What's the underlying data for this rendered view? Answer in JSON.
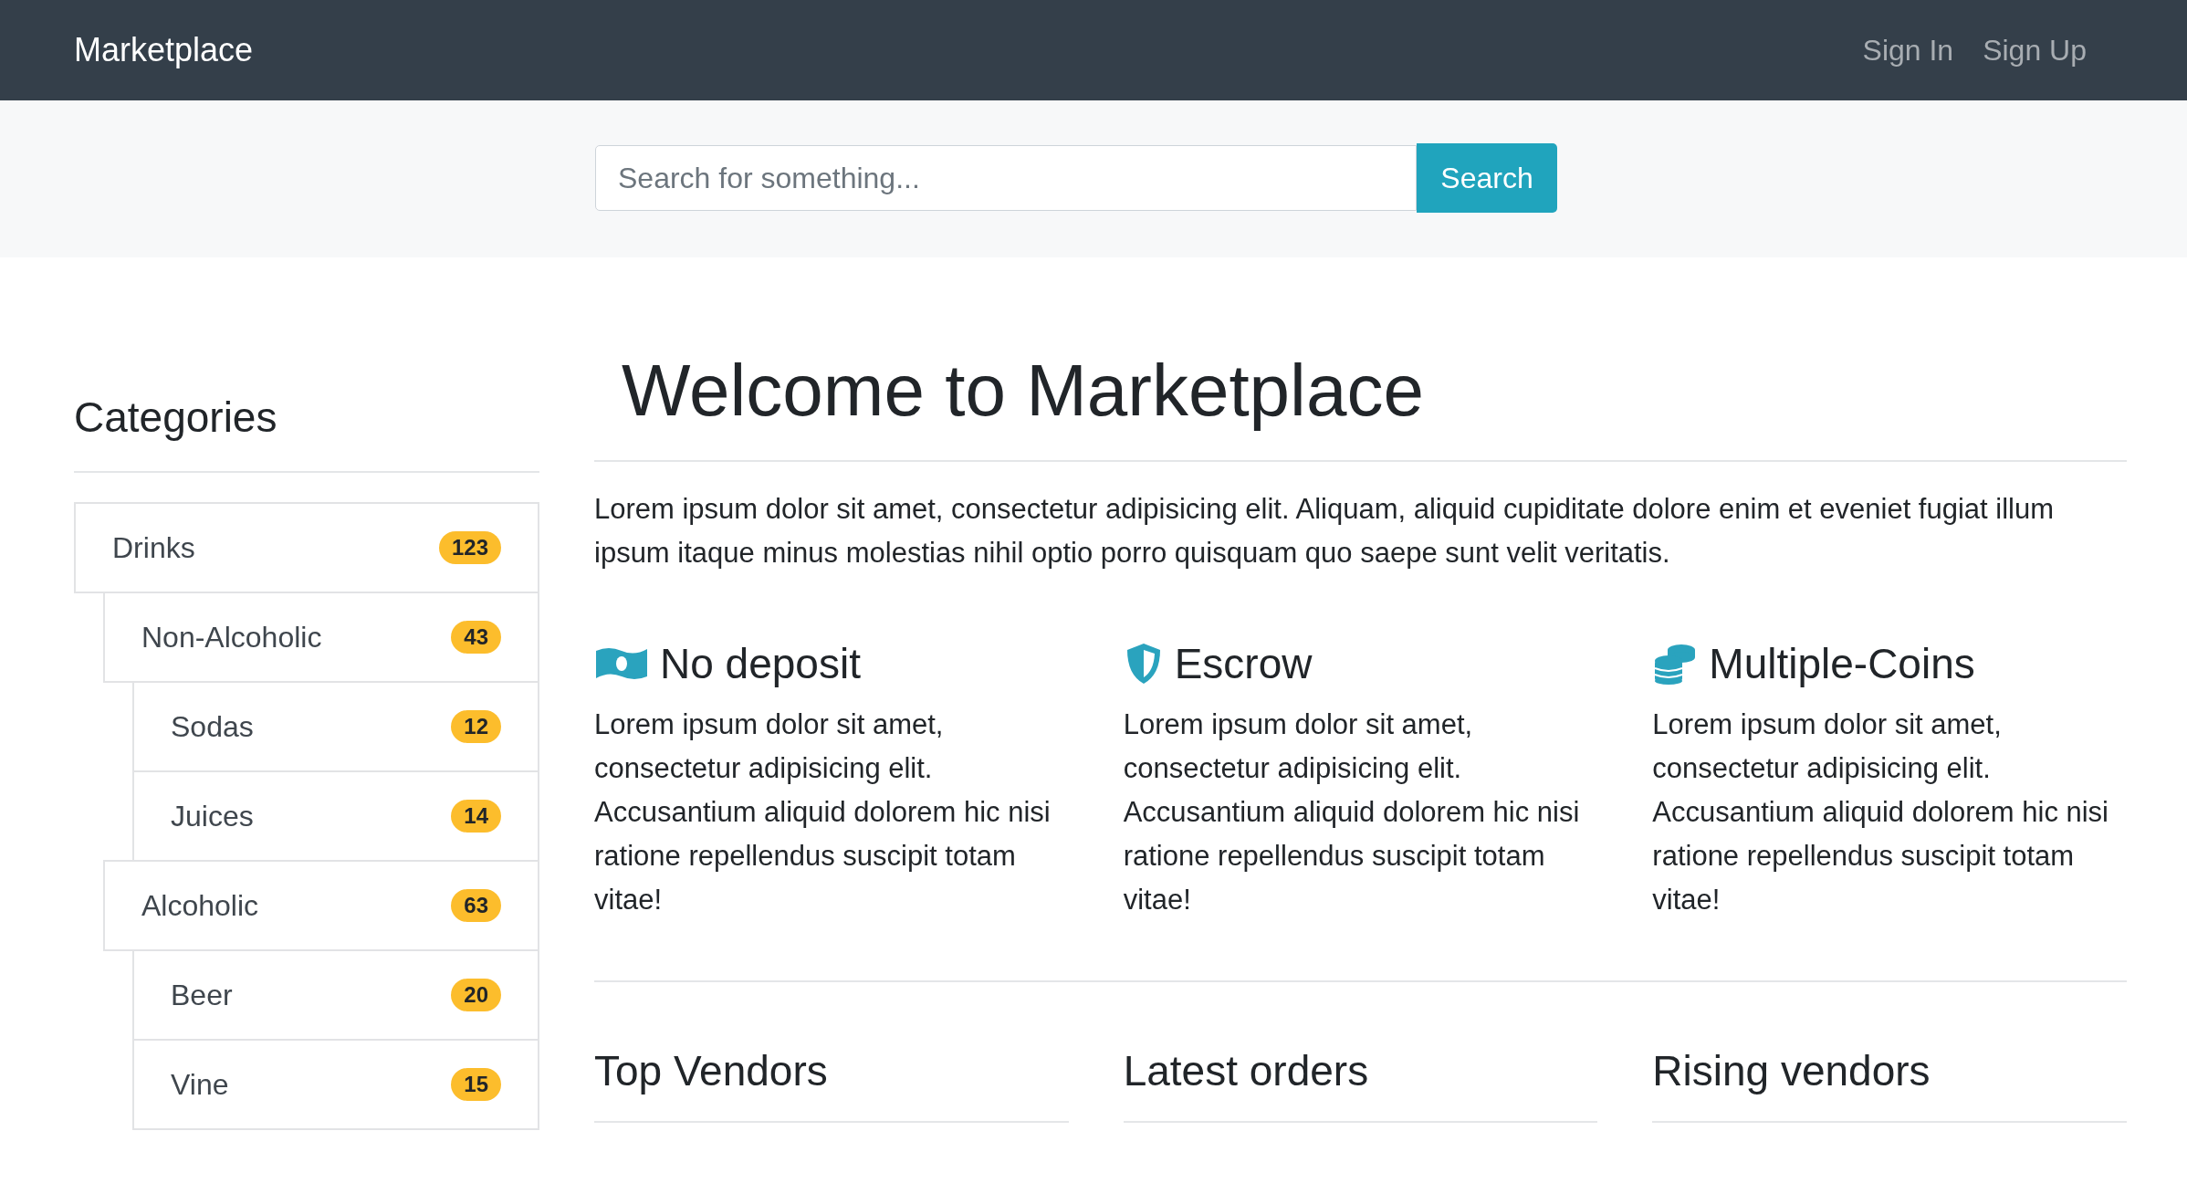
{
  "navbar": {
    "brand": "Marketplace",
    "links": [
      "Sign In",
      "Sign Up"
    ]
  },
  "search": {
    "placeholder": "Search for something...",
    "button": "Search"
  },
  "sidebar": {
    "title": "Categories",
    "items": [
      {
        "label": "Drinks",
        "count": "123",
        "children": [
          {
            "label": "Non-Alcoholic",
            "count": "43",
            "children": [
              {
                "label": "Sodas",
                "count": "12"
              },
              {
                "label": "Juices",
                "count": "14"
              }
            ]
          },
          {
            "label": "Alcoholic",
            "count": "63",
            "children": [
              {
                "label": "Beer",
                "count": "20"
              },
              {
                "label": "Vine",
                "count": "15"
              }
            ]
          }
        ]
      }
    ]
  },
  "main": {
    "title": "Welcome to Marketplace",
    "intro": "Lorem ipsum dolor sit amet, consectetur adipisicing elit. Aliquam, aliquid cupiditate dolore enim et eveniet fugiat illum ipsum itaque minus molestias nihil optio porro quisquam quo saepe sunt velit veritatis.",
    "features": [
      {
        "kind": "money",
        "title": "No deposit",
        "text": "Lorem ipsum dolor sit amet, consectetur adipisicing elit. Accusantium aliquid dolorem hic nisi ratione repellendus suscipit totam vitae!"
      },
      {
        "kind": "shield",
        "title": "Escrow",
        "text": "Lorem ipsum dolor sit amet, consectetur adipisicing elit. Accusantium aliquid dolorem hic nisi ratione repellendus suscipit totam vitae!"
      },
      {
        "kind": "coins",
        "title": "Multiple-Coins",
        "text": "Lorem ipsum dolor sit amet, consectetur adipisicing elit. Accusantium aliquid dolorem hic nisi ratione repellendus suscipit totam vitae!"
      }
    ],
    "sections": [
      "Top Vendors",
      "Latest orders",
      "Rising vendors"
    ]
  }
}
